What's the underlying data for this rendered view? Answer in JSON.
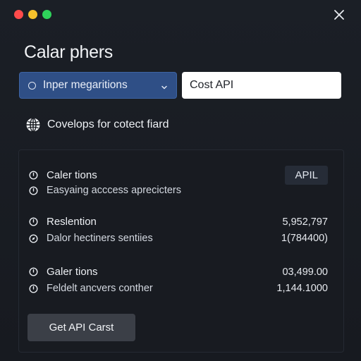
{
  "window": {
    "title": "Calar phers"
  },
  "toolbar": {
    "select_label": "Inper megaritions",
    "input_value": "Cost API"
  },
  "info": {
    "text": "Covelops for cotect fiard"
  },
  "panel": {
    "rows": [
      {
        "label": "Caler tions",
        "badge": "APIL"
      },
      {
        "label": "Easyaing acccess aprecicters"
      },
      {
        "label": "Reslention",
        "value": "5,952,797"
      },
      {
        "label": "Dalor hectiners sentiies",
        "value": "1(784400)"
      },
      {
        "label": "Galer tions",
        "value": "03,499.00"
      },
      {
        "label": "Feldelt ancvers conther",
        "value": "1,144.1000"
      }
    ],
    "button_label": "Get API Carst"
  },
  "colors": {
    "select_bg": "#2f4f86",
    "close_red": "#ff4b4b",
    "minimize_yellow": "#f5c12c",
    "maximize_green": "#2fd35b"
  }
}
